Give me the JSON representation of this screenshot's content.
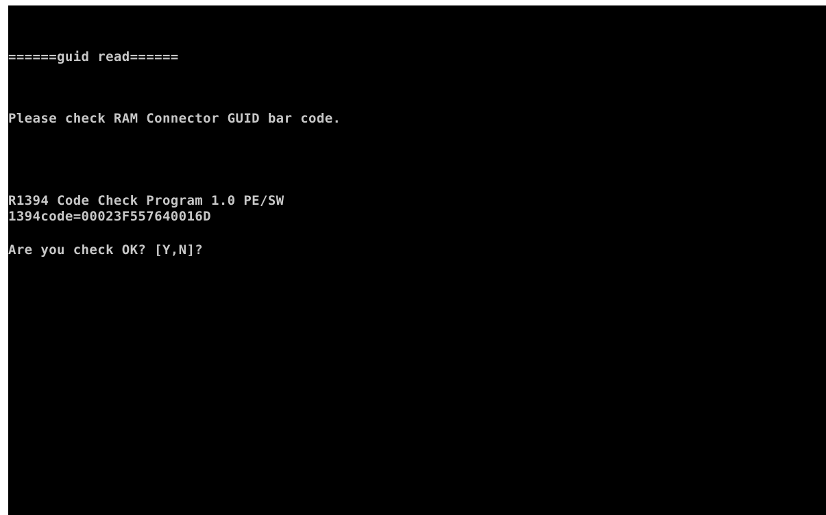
{
  "console": {
    "background": "#000000",
    "text_color": "#c8c8c8",
    "lines": {
      "header": "======guid read======",
      "instruction": "Please check RAM Connector GUID bar code.",
      "program": "R1394 Code Check Program 1.0 PE/SW",
      "code": "1394code=00023F557640016D",
      "prompt": "Are you check OK? [Y,N]?"
    }
  }
}
